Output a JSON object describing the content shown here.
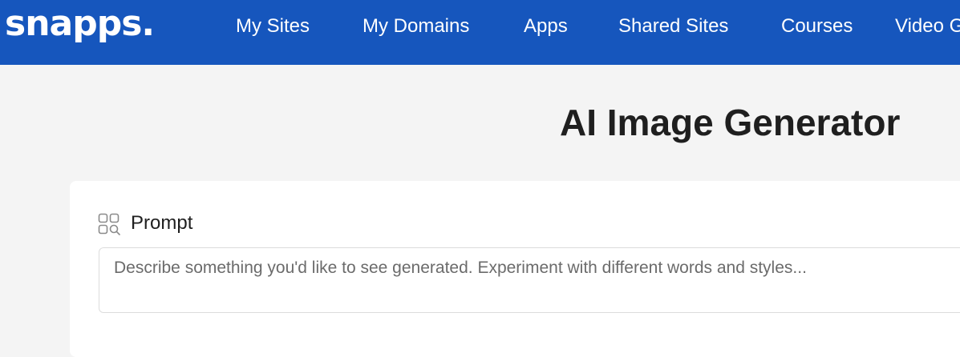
{
  "header": {
    "logo_text": "snapps.",
    "nav": [
      {
        "label": "My Sites"
      },
      {
        "label": "My Domains"
      },
      {
        "label": "Apps"
      },
      {
        "label": "Shared Sites"
      },
      {
        "label": "Courses"
      },
      {
        "label": "Video G"
      }
    ]
  },
  "main": {
    "title": "AI Image Generator",
    "prompt": {
      "label": "Prompt",
      "icon": "image-search-icon",
      "value": "",
      "placeholder": "Describe something you'd like to see generated. Experiment with different words and styles..."
    }
  },
  "colors": {
    "nav_background": "#1656bd",
    "page_background": "#f4f4f4",
    "card_background": "#ffffff",
    "title_text": "#1f1f1f"
  }
}
